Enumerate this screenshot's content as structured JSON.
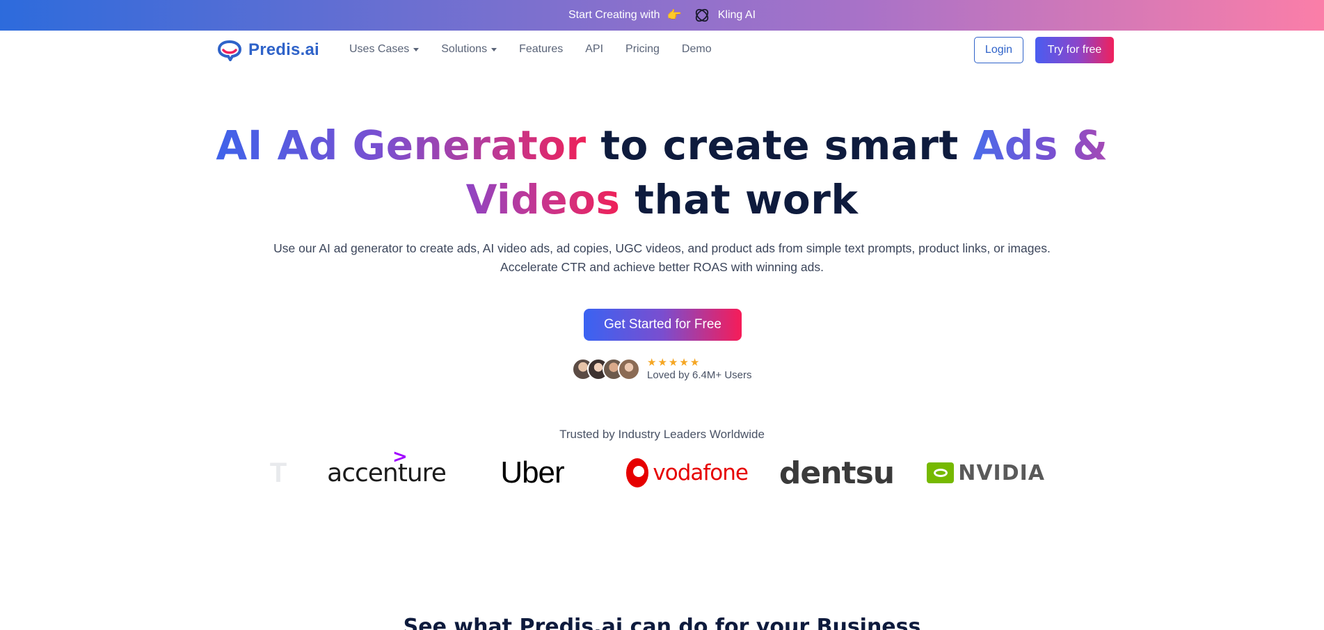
{
  "announcement": {
    "text": "Start Creating with",
    "emoji": "👉",
    "partner": "Kling AI",
    "gradient": [
      "#2d6bdc",
      "#fb7ea8"
    ]
  },
  "nav": {
    "brand": "Predis.ai",
    "menu": [
      {
        "label": "Uses Cases",
        "dropdown": true
      },
      {
        "label": "Solutions",
        "dropdown": true
      },
      {
        "label": "Features",
        "dropdown": false
      },
      {
        "label": "API",
        "dropdown": false
      },
      {
        "label": "Pricing",
        "dropdown": false
      },
      {
        "label": "Demo",
        "dropdown": false
      }
    ],
    "login": "Login",
    "try_free": "Try for free"
  },
  "hero": {
    "headline_part1": "AI Ad Generator",
    "headline_part2": " to create smart ",
    "headline_part3": "Ads &",
    "headline_part4": "Videos",
    "headline_part5": " that work",
    "subtitle_line1": "Use our AI ad generator to create ads, AI video ads, ad copies, UGC videos, and product ads from simple text prompts, product links, or images.",
    "subtitle_line2": "Accelerate CTR and achieve better ROAS with winning ads.",
    "cta": "Get Started for Free",
    "rating_stars": 5,
    "star_glyph": "★",
    "social_proof": "Loved by 6.4M+ Users"
  },
  "trusted": {
    "title": "Trusted by Industry Leaders Worldwide",
    "partial_logo": "T",
    "logos": [
      "accenture",
      "Uber",
      "vodafone",
      "dentsu",
      "NVIDIA"
    ]
  },
  "next_section": {
    "title": "See what Predis.ai can do for your Business"
  },
  "colors": {
    "brand_blue": "#2f63c9",
    "cta_gradient_start": "#3a63f2",
    "cta_gradient_end": "#f61c58",
    "heading_navy": "#0e1b3d",
    "star_gold": "#f5a623"
  }
}
